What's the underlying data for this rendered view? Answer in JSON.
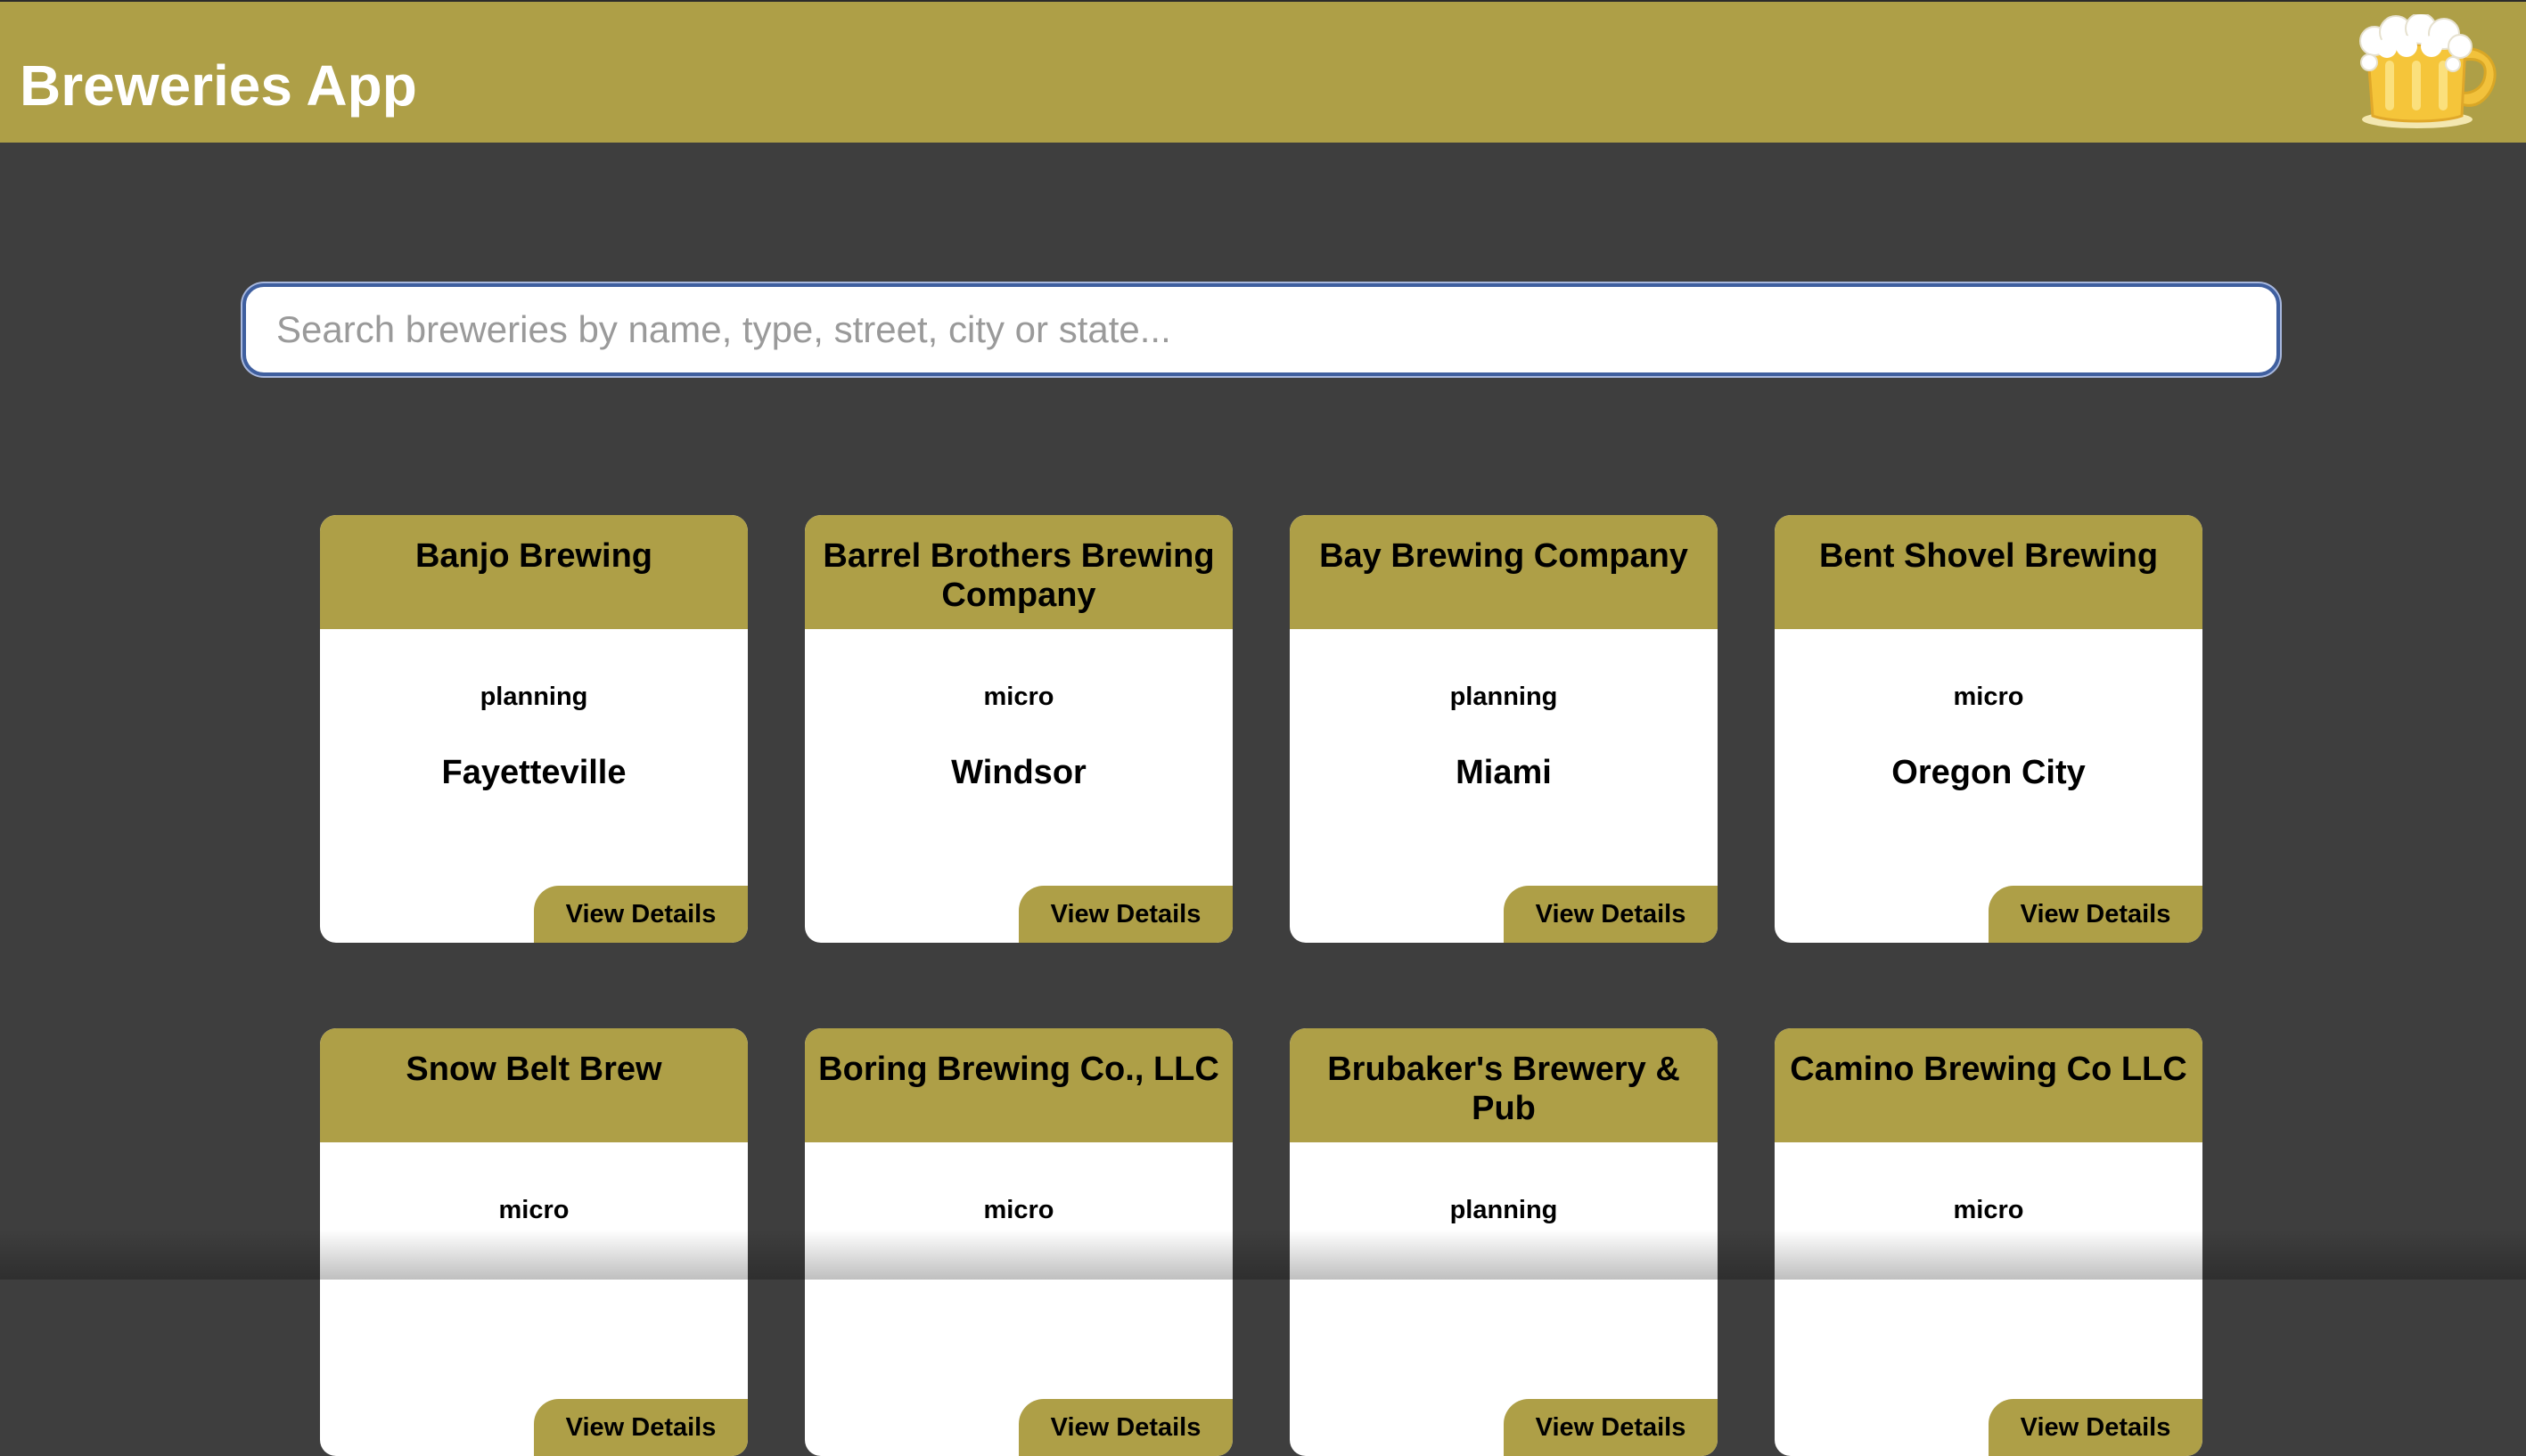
{
  "header": {
    "title": "Breweries App",
    "logo_icon": "beer-mug-icon",
    "background": "#ae9f47"
  },
  "search": {
    "placeholder": "Search breweries by name, type, street, city or state...",
    "value": ""
  },
  "colors": {
    "accent": "#ae9f47",
    "page_background": "#3e3e3e",
    "card_background": "#ffffff"
  },
  "breweries": [
    {
      "name": "Banjo Brewing",
      "type": "planning",
      "city": "Fayetteville",
      "button": "View Details"
    },
    {
      "name": "Barrel Brothers Brewing Company",
      "type": "micro",
      "city": "Windsor",
      "button": "View Details"
    },
    {
      "name": "Bay Brewing Company",
      "type": "planning",
      "city": "Miami",
      "button": "View Details"
    },
    {
      "name": "Bent Shovel Brewing",
      "type": "micro",
      "city": "Oregon City",
      "button": "View Details"
    },
    {
      "name": "Snow Belt Brew",
      "type": "micro",
      "city": "",
      "button": "View Details"
    },
    {
      "name": "Boring Brewing Co., LLC",
      "type": "micro",
      "city": "",
      "button": "View Details"
    },
    {
      "name": "Brubaker's Brewery & Pub",
      "type": "planning",
      "city": "",
      "button": "View Details"
    },
    {
      "name": "Camino Brewing Co LLC",
      "type": "micro",
      "city": "",
      "button": "View Details"
    }
  ]
}
